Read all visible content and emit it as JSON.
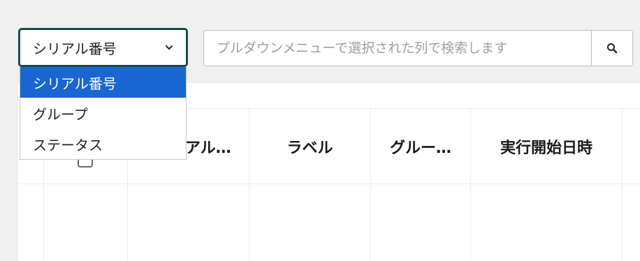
{
  "search": {
    "select_value": "シリアル番号",
    "placeholder": "プルダウンメニューで選択された列で検索します",
    "dropdown_options": [
      "シリアル番号",
      "グループ",
      "ステータス"
    ],
    "selected_index": 0
  },
  "table": {
    "columns": [
      "",
      "",
      "アル…",
      "ラベル",
      "グルー…",
      "実行開始日時",
      ""
    ]
  },
  "icons": {
    "select": "chevron-down-icon",
    "search": "search-icon"
  },
  "colors": {
    "select_border": "#1b4a4a",
    "option_selected_bg": "#1a66d2"
  }
}
